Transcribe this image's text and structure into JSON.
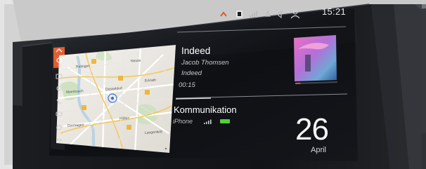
{
  "status_bar": {
    "time": "15:21",
    "icons": [
      "chevron-up-icon",
      "bluetooth-box-icon",
      "signal-bars-icon",
      "wifi-icon",
      "volume-icon",
      "user-profile-icon"
    ]
  },
  "sidebar": {
    "items": [
      "home-icon",
      "navigation-icon",
      "radio-icon",
      "media-icon",
      "phone-icon",
      "car-icon",
      "settings-icon",
      "apps-icon"
    ]
  },
  "map": {
    "labels": [
      "Ratingen",
      "Neuss",
      "Meerbusch",
      "Düsseldorf",
      "Erkrath",
      "Hilden",
      "Dormagen",
      "Langenfeld"
    ]
  },
  "media": {
    "title": "Indeed",
    "artist": "Jacob Thomsen",
    "album": "Indeed",
    "elapsed": "00:15",
    "progress": 0.12
  },
  "communication": {
    "title": "Kommunikation",
    "phone_label": "iPhone"
  },
  "date": {
    "day": "26",
    "month": "April"
  },
  "colors": {
    "accent": "#e2572b",
    "battery_green": "#4fd13a",
    "screen": "#111318"
  }
}
